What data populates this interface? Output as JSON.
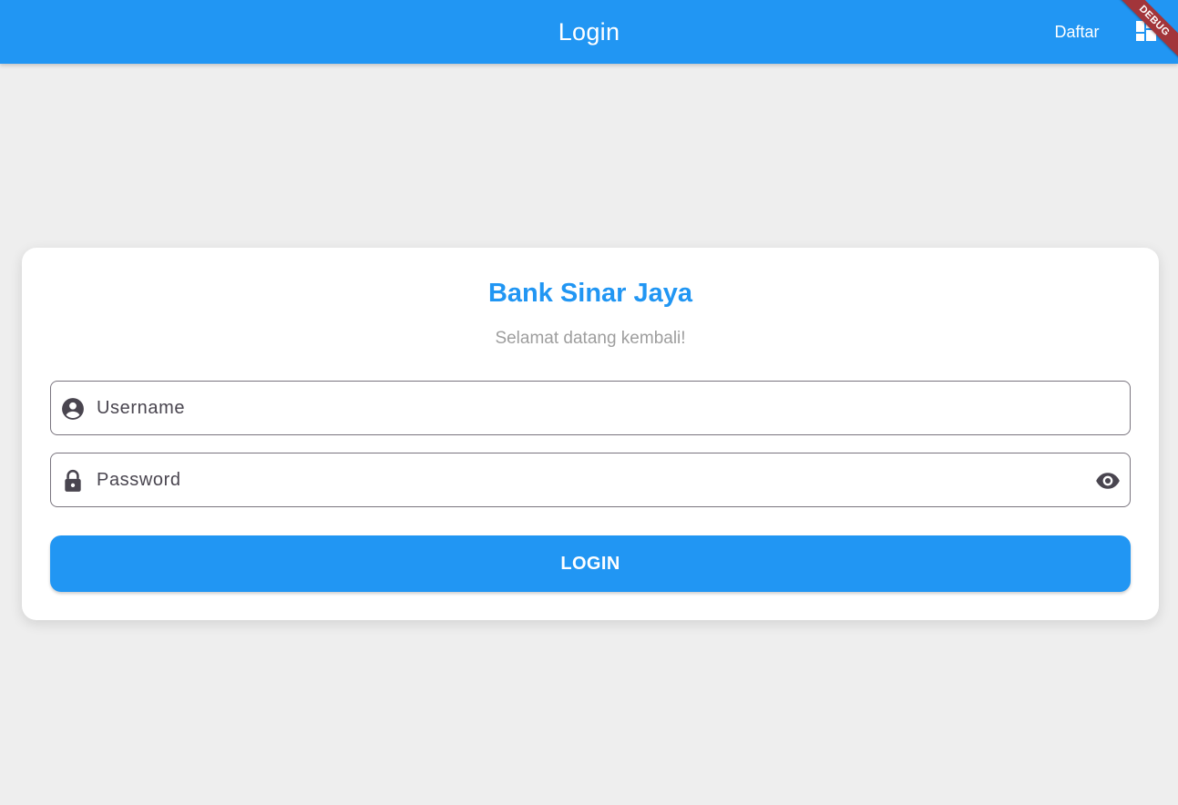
{
  "app_bar": {
    "title": "Login",
    "register_label": "Daftar",
    "layout_icon": "dashboard-layout-icon",
    "debug_label": "DEBUG",
    "color": "#2196f3"
  },
  "card": {
    "title": "Bank Sinar Jaya",
    "subtitle": "Selamat datang kembali!",
    "username": {
      "placeholder": "Username",
      "value": "",
      "icon": "account-circle-icon"
    },
    "password": {
      "placeholder": "Password",
      "value": "",
      "icon": "lock-icon",
      "toggle_icon": "visibility-icon"
    },
    "login_label": "LOGIN"
  },
  "colors": {
    "primary": "#2196f3",
    "background": "#eeeeee",
    "subtitle": "#9e9e9e",
    "debug_banner": "#a2353a"
  }
}
